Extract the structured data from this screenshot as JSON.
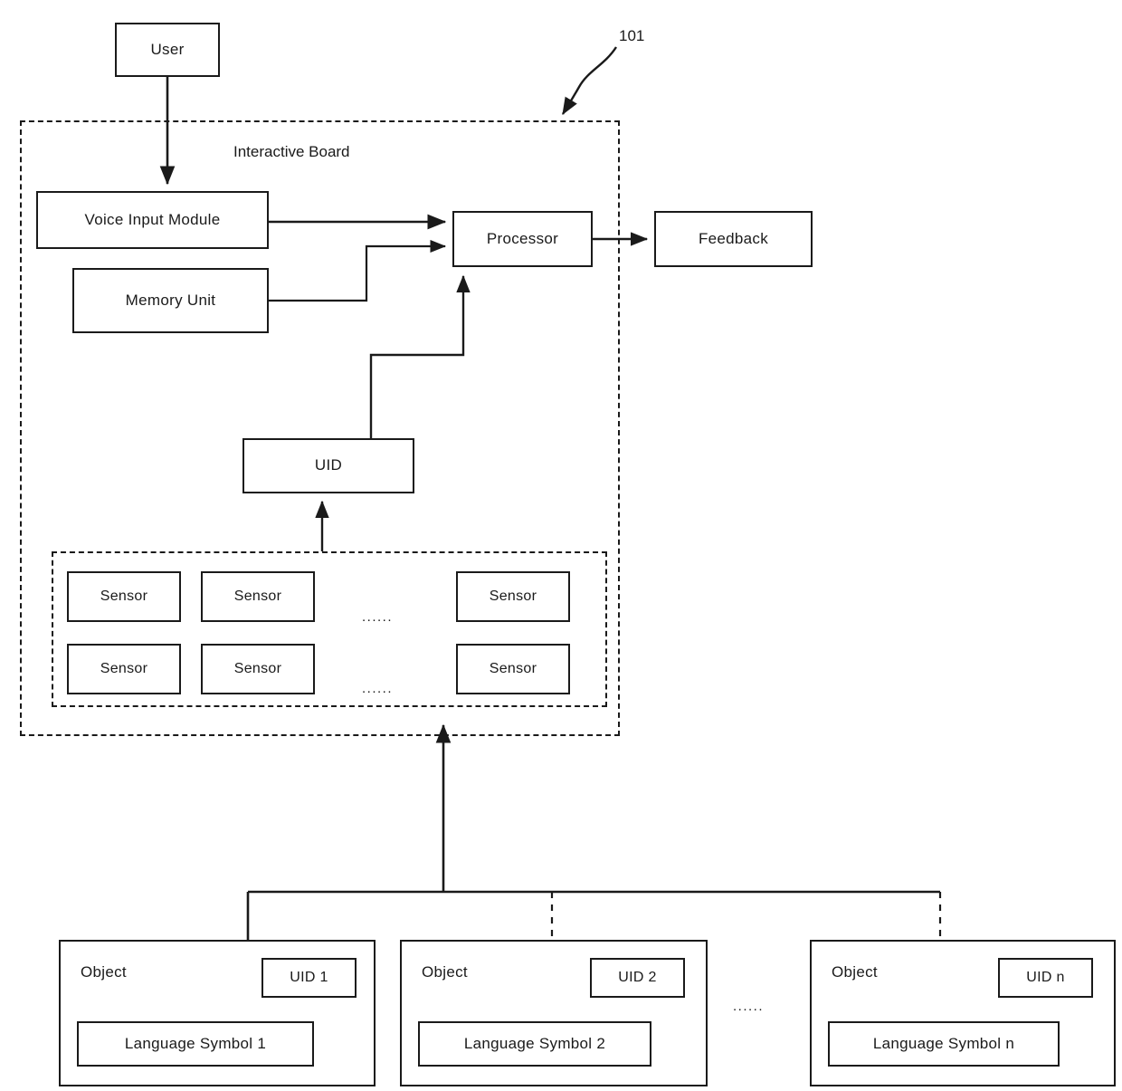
{
  "diagram": {
    "reference_numeral": "101",
    "board_title": "Interactive Board",
    "user_label": "User",
    "voice_input_label": "Voice Input Module",
    "memory_label": "Memory Unit",
    "processor_label": "Processor",
    "feedback_label": "Feedback",
    "uid_label": "UID",
    "sensor_ellipsis_top": "......",
    "sensor_ellipsis_bottom": "......",
    "object_ellipsis": "......",
    "sensors": [
      {
        "label": "Sensor"
      },
      {
        "label": "Sensor"
      },
      {
        "label": "Sensor"
      },
      {
        "label": "Sensor"
      },
      {
        "label": "Sensor"
      },
      {
        "label": "Sensor"
      }
    ],
    "objects": [
      {
        "title": "Object",
        "uid": "UID 1",
        "symbol": "Language Symbol 1"
      },
      {
        "title": "Object",
        "uid": "UID 2",
        "symbol": "Language Symbol 2"
      },
      {
        "title": "Object",
        "uid": "UID n",
        "symbol": "Language Symbol n"
      }
    ]
  },
  "colors": {
    "stroke": "#1a1a1a",
    "background": "#ffffff"
  }
}
